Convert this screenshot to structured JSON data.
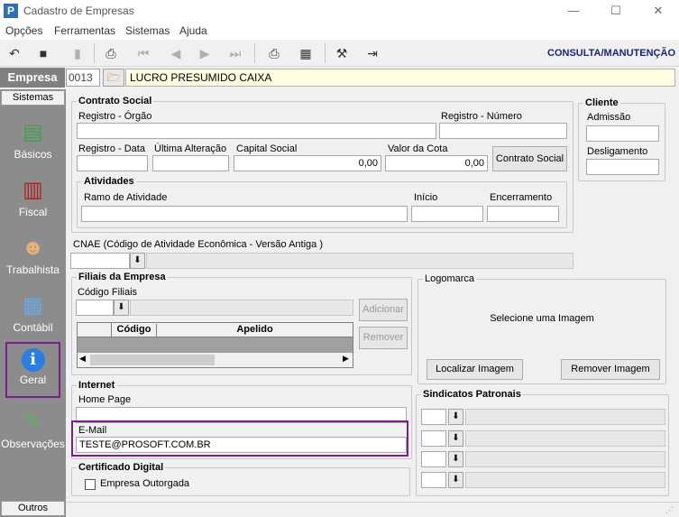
{
  "window": {
    "app_icon": "P",
    "title": "Cadastro de Empresas",
    "minimize": "—",
    "maximize": "☐",
    "close": "✕"
  },
  "menu": [
    "Opções",
    "Ferramentas",
    "Sistemas",
    "Ajuda"
  ],
  "toolbar": {
    "mode": "CONSULTA/MANUTENÇÃO"
  },
  "empresa": {
    "label": "Empresa",
    "code": "0013",
    "name": "LUCRO PRESUMIDO CAIXA"
  },
  "sidebar": {
    "header": "Sistemas",
    "footer": "Outros",
    "items": [
      "Básicos",
      "Fiscal",
      "Trabalhista",
      "Contábil",
      "Geral",
      "Observações"
    ]
  },
  "contrato": {
    "title": "Contrato Social",
    "registro_orgao": "Registro - Órgão",
    "registro_numero": "Registro - Número",
    "registro_data": "Registro - Data",
    "ultima_alteracao": "Última Alteração",
    "capital_social": "Capital Social",
    "capital_value": "0,00",
    "valor_cota": "Valor da Cota",
    "cota_value": "0,00",
    "button": "Contrato Social"
  },
  "atividades": {
    "title": "Atividades",
    "ramo": "Ramo de Atividade",
    "inicio": "Início",
    "encerramento": "Encerramento"
  },
  "cliente": {
    "title": "Cliente",
    "admissao": "Admissão",
    "desligamento": "Desligamento"
  },
  "cnae": {
    "label": "CNAE (Código de Atividade Econômica - Versão Antiga )"
  },
  "filiais": {
    "title": "Filiais da Empresa",
    "codigo_label": "Código Filiais",
    "col_codigo": "Código",
    "col_apelido": "Apelido",
    "adicionar": "Adicionar",
    "remover": "Remover"
  },
  "logomarca": {
    "title": "Logomarca",
    "prompt": "Selecione  uma   Imagem",
    "localizar": "Localizar Imagem",
    "remover": "Remover Imagem"
  },
  "internet": {
    "title": "Internet",
    "home_page": "Home Page",
    "email_label": "E-Mail",
    "email_value": "TESTE@PROSOFT.COM.BR"
  },
  "sindicatos": {
    "title": "Sindicatos Patronais"
  },
  "certificado": {
    "title": "Certificado Digital",
    "outorgada": "Empresa Outorgada"
  }
}
